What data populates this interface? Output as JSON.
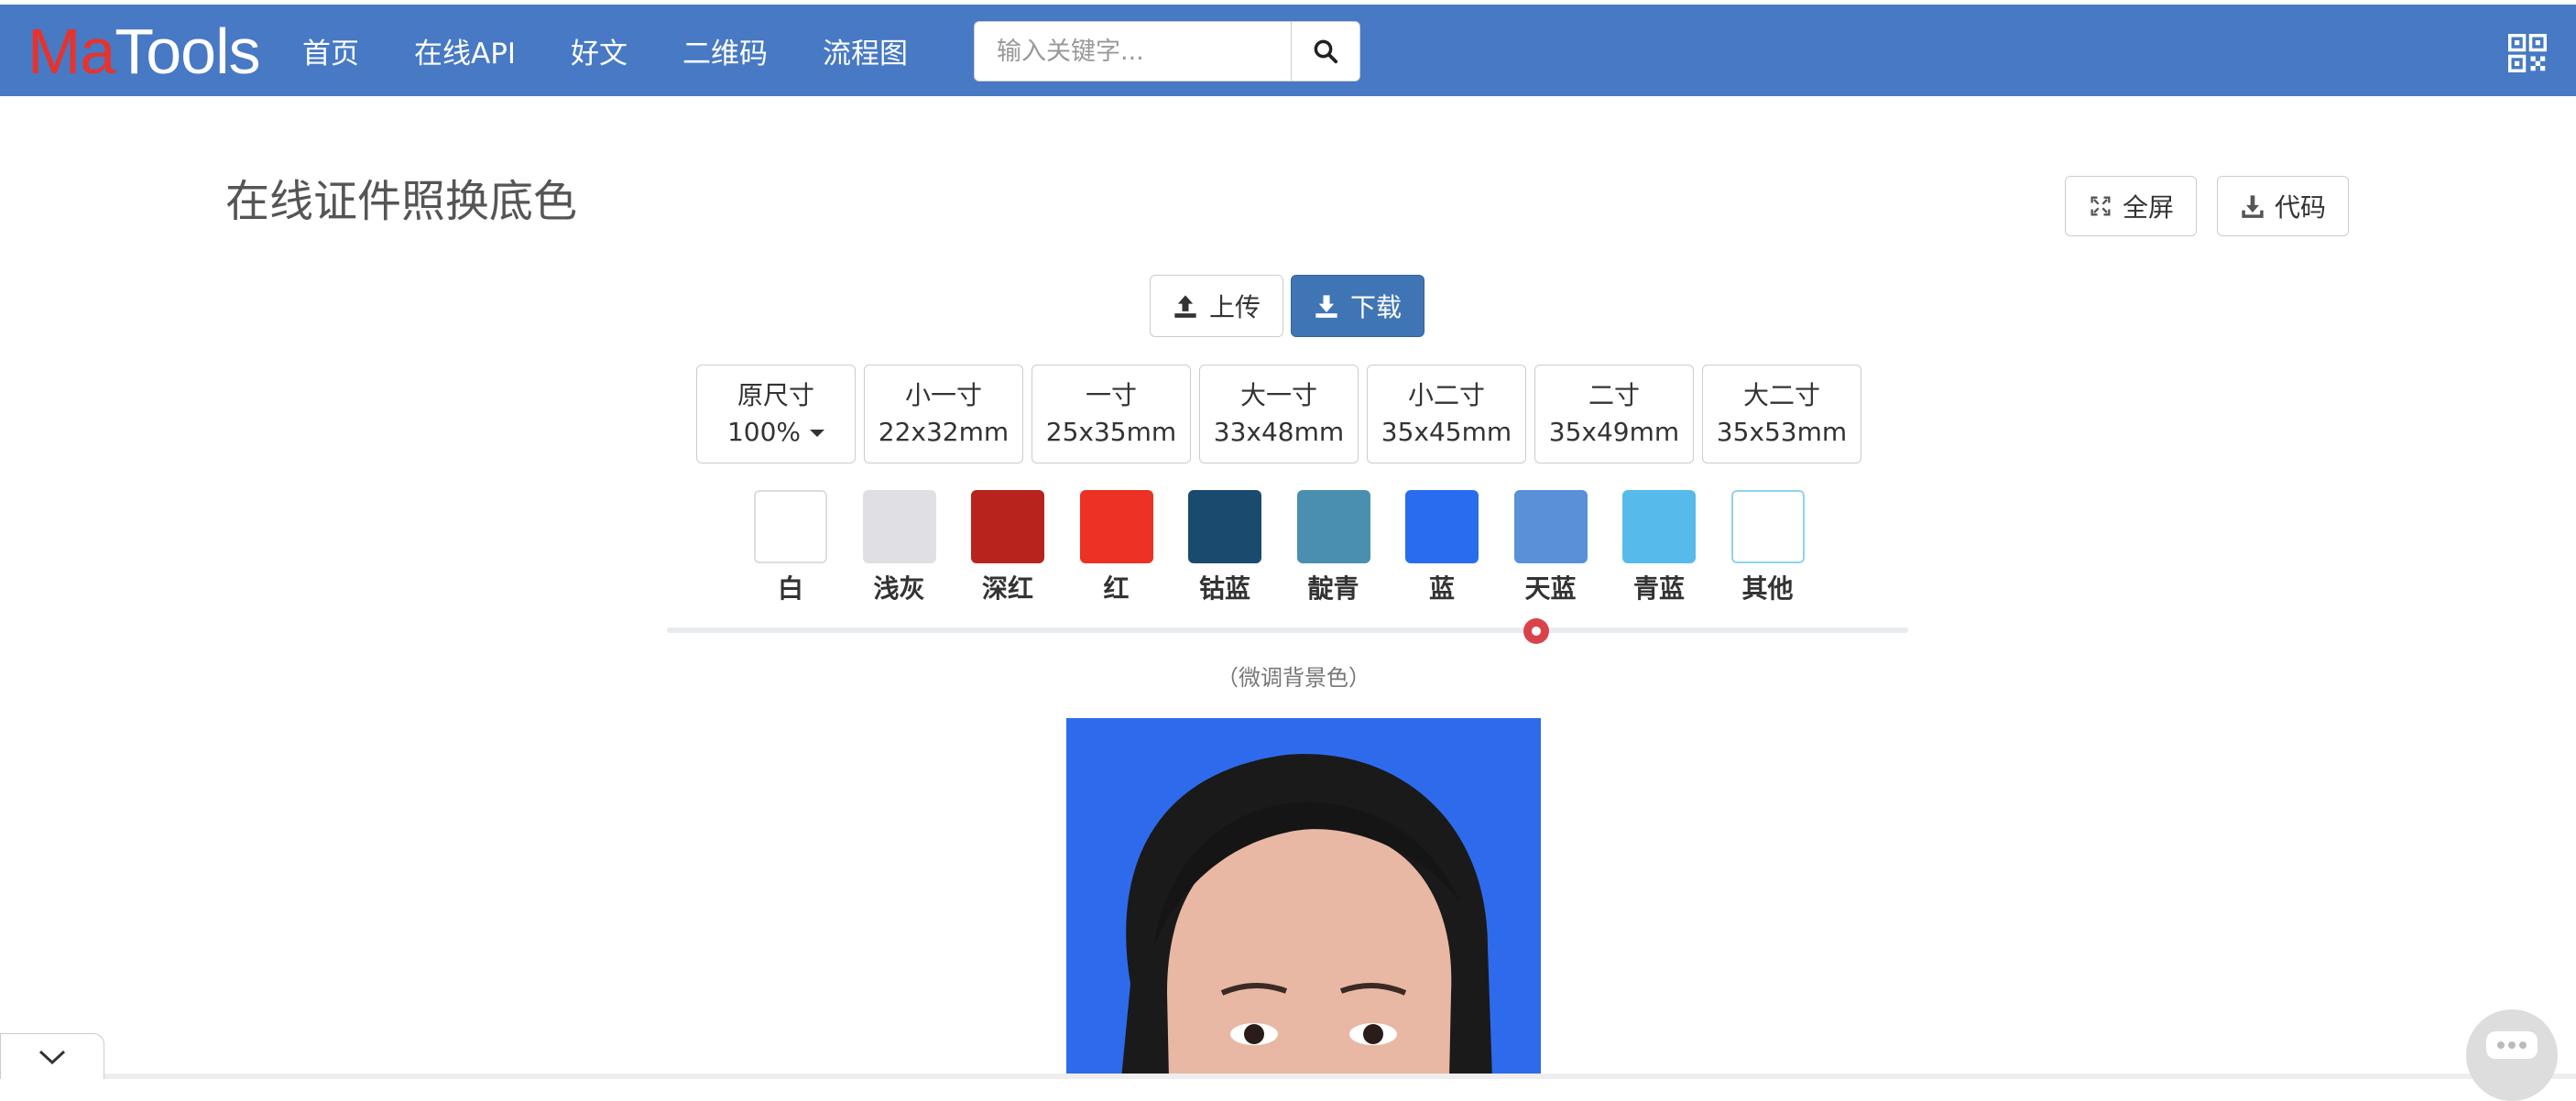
{
  "header": {
    "logo_ma": "Ma",
    "logo_tools": "Tools",
    "nav": [
      "首页",
      "在线API",
      "好文",
      "二维码",
      "流程图"
    ],
    "search_placeholder": "输入关键字..."
  },
  "page": {
    "title": "在线证件照换底色",
    "fullscreen_label": "全屏",
    "code_label": "代码",
    "upload_label": "上传",
    "download_label": "下载"
  },
  "sizes": [
    {
      "name": "原尺寸",
      "value": "100%",
      "dropdown": true
    },
    {
      "name": "小一寸",
      "value": "22x32mm"
    },
    {
      "name": "一寸",
      "value": "25x35mm"
    },
    {
      "name": "大一寸",
      "value": "33x48mm"
    },
    {
      "name": "小二寸",
      "value": "35x45mm"
    },
    {
      "name": "二寸",
      "value": "35x49mm"
    },
    {
      "name": "大二寸",
      "value": "35x53mm"
    }
  ],
  "colors": [
    {
      "label": "白",
      "hex": "#ffffff",
      "border": "#dddddd"
    },
    {
      "label": "浅灰",
      "hex": "#e0e0e4",
      "border": "#e0e0e4"
    },
    {
      "label": "深红",
      "hex": "#b8231d",
      "border": "#b8231d"
    },
    {
      "label": "红",
      "hex": "#ec3125",
      "border": "#ec3125"
    },
    {
      "label": "钴蓝",
      "hex": "#1b4a6f",
      "border": "#1b4a6f"
    },
    {
      "label": "靛青",
      "hex": "#4a8fb0",
      "border": "#4a8fb0"
    },
    {
      "label": "蓝",
      "hex": "#2a6cef",
      "border": "#2a6cef"
    },
    {
      "label": "天蓝",
      "hex": "#5990d7",
      "border": "#5990d7"
    },
    {
      "label": "青蓝",
      "hex": "#56bbea",
      "border": "#56bbea"
    },
    {
      "label": "其他",
      "hex": "#ffffff",
      "border": "#8fd3ef"
    }
  ],
  "slider": {
    "hint": "（微调背景色）",
    "level": 0.7,
    "accent": "#d9434b"
  },
  "theme": {
    "navbar": "#4779c4",
    "primary_button": "#3f75b5",
    "photo_background": "#2e6bec"
  }
}
